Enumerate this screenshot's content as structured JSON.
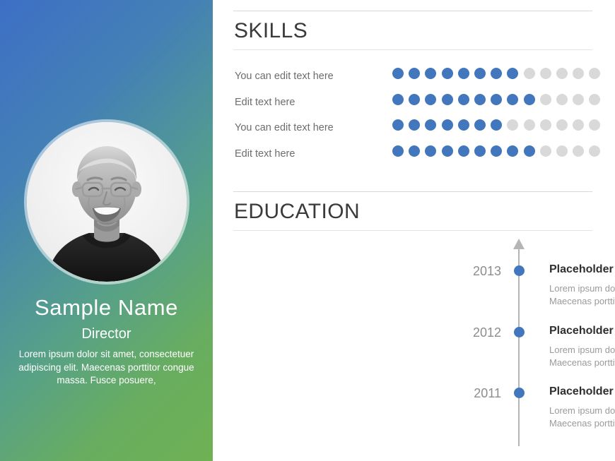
{
  "profile": {
    "name": "Sample Name",
    "role": "Director",
    "bio": "Lorem ipsum dolor sit amet, consectetuer adipiscing elit. Maecenas porttitor congue massa. Fusce posuere,",
    "photo_alt": "portrait-photo"
  },
  "theme": {
    "accent_blue": "#4277bd",
    "dot_empty": "#d9d9d9",
    "gradient_start": "#3d6fc6",
    "gradient_end": "#6fb153",
    "heading_color": "#3a3a3a",
    "label_color": "#6d6d6d",
    "muted_color": "#9a9a9a",
    "rule_color": "#d8d8d8"
  },
  "skills": {
    "title": "SKILLS",
    "total_dots": 13,
    "rows": [
      {
        "label": "You can edit text here",
        "filled": 8
      },
      {
        "label": "Edit text here",
        "filled": 9
      },
      {
        "label": "You can edit text here",
        "filled": 7
      },
      {
        "label": "Edit text here",
        "filled": 9
      }
    ]
  },
  "education": {
    "title": "EDUCATION",
    "items": [
      {
        "year": "2013",
        "title": "Placeholder",
        "description": "Lorem ipsum dolor sit amet, consectetuer adipiscing elit. Maecenas porttitor"
      },
      {
        "year": "2012",
        "title": "Placeholder",
        "description": "Lorem ipsum dolor sit amet, consectetuer adipiscing elit. Maecenas porttitor"
      },
      {
        "year": "2011",
        "title": "Placeholder",
        "description": "Lorem ipsum dolor sit amet, consectetuer adipiscing elit. Maecenas porttitor"
      }
    ]
  }
}
